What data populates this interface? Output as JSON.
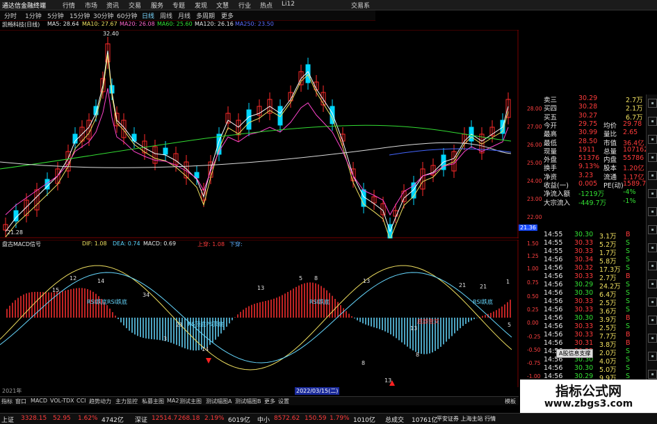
{
  "menu": {
    "app_title": "通达信金融终端",
    "items": [
      "行情",
      "市场",
      "资讯",
      "交易",
      "服务",
      "专题",
      "发现",
      "文慧",
      "行业",
      "热点",
      "Li12"
    ],
    "right_label": "交易系"
  },
  "period_tabs": [
    "分时",
    "1分钟",
    "5分钟",
    "15分钟",
    "30分钟",
    "60分钟",
    "日线",
    "周线",
    "月线",
    "多周期",
    "更多"
  ],
  "main_indicator": {
    "title": "凯畅科技(日线)",
    "ma5": "MA5: 28.64",
    "ma10": "MA10: 27.67",
    "ma20": "MA20: 26.08",
    "ma60": "MA60: 25.60",
    "ma120": "MA120: 26.16",
    "ma250": "MA250: 23.50",
    "high_mark": "32.40",
    "low_mark": "21.28",
    "last_price_tag": "21.36"
  },
  "macd_indicator": {
    "title": "盘古MACD信号",
    "dif": "DIF: 1.08",
    "dea": "DEA: 0.74",
    "macd": "MACD: 0.69",
    "up_label": "上穿: 1.08",
    "down_label": "下穿:",
    "labels": [
      "RSI跌底RSI跌底",
      "RSI跌底",
      "RSI跌底",
      "KS顶底PS顶底",
      "底部金叉"
    ],
    "numbers": [
      "12",
      "14",
      "15",
      "34",
      "13",
      "5",
      "8",
      "13",
      "3",
      "14",
      "21",
      "13",
      "8",
      "13",
      "21",
      "21",
      "1",
      "5",
      "8"
    ]
  },
  "right_scale": [
    "28.00",
    "27.00",
    "26.00",
    "25.00",
    "24.00",
    "23.00",
    "22.00",
    "1.50",
    "1.25",
    "1.00",
    "0.75",
    "0.50",
    "0.25",
    "0.00",
    "-0.25",
    "-0.50",
    "-0.75",
    "-1.00",
    "-1.25",
    "-1.50"
  ],
  "quote": [
    {
      "label": "卖三",
      "price": "30.29",
      "vol": "2.7万"
    },
    {
      "label": "买四",
      "price": "30.28",
      "vol": "2.1万"
    },
    {
      "label": "买五",
      "price": "30.27",
      "vol": "6.7万"
    },
    {
      "label": "今开",
      "price": "29.75",
      "label2": "均价",
      "val2": "29.78"
    },
    {
      "label": "最高",
      "price": "30.99",
      "label2": "量比",
      "val2": "2.65"
    },
    {
      "label": "最低",
      "price": "28.50",
      "label2": "市值",
      "val2": "36.4亿"
    },
    {
      "label": "现量",
      "price": "1911",
      "label2": "总量",
      "val2": "107162"
    },
    {
      "label": "外盘",
      "price": "51376",
      "label2": "内盘",
      "val2": "55786"
    },
    {
      "label": "换手",
      "price": "9.13%",
      "label2": "股本",
      "val2": "1.20亿"
    },
    {
      "label": "净资",
      "price": "3.23",
      "label2": "流通",
      "val2": "1.17亿"
    },
    {
      "label": "收益(一)",
      "price": "0.005",
      "label2": "PE(动)",
      "val2": "1589.7"
    },
    {
      "label": "净流入额",
      "price": "-1219万",
      "label2": "",
      "val2": "-4%"
    },
    {
      "label": "大宗流入",
      "price": "-449.7万",
      "label2": "",
      "val2": "-1%"
    }
  ],
  "ticks": [
    {
      "t": "14:55",
      "p": "30.30",
      "v": "3.1万",
      "d": "B"
    },
    {
      "t": "14:55",
      "p": "30.33",
      "v": "5.2万",
      "d": "S"
    },
    {
      "t": "14:55",
      "p": "30.33",
      "v": "1.7万",
      "d": "S"
    },
    {
      "t": "14:56",
      "p": "30.34",
      "v": "5.8万",
      "d": "S"
    },
    {
      "t": "14:56",
      "p": "30.32",
      "v": "17.3万",
      "d": "S"
    },
    {
      "t": "14:56",
      "p": "30.33",
      "v": "2.7万",
      "d": "B"
    },
    {
      "t": "14:56",
      "p": "30.29",
      "v": "24.2万",
      "d": "S"
    },
    {
      "t": "14:56",
      "p": "30.30",
      "v": "6.4万",
      "d": "S"
    },
    {
      "t": "14:56",
      "p": "30.33",
      "v": "2.5万",
      "d": "S"
    },
    {
      "t": "14:56",
      "p": "30.33",
      "v": "3.6万",
      "d": "S"
    },
    {
      "t": "14:56",
      "p": "30.30",
      "v": "3.9万",
      "d": "B"
    },
    {
      "t": "14:56",
      "p": "30.33",
      "v": "2.5万",
      "d": "S"
    },
    {
      "t": "14:56",
      "p": "30.33",
      "v": "7.7万",
      "d": "B"
    },
    {
      "t": "14:56",
      "p": "30.31",
      "v": "3.8万",
      "d": "B"
    },
    {
      "t": "14:56",
      "p": "30.32",
      "v": "2.0万",
      "d": "S"
    },
    {
      "t": "14:56",
      "p": "30.30",
      "v": "4.0万",
      "d": "S"
    },
    {
      "t": "14:56",
      "p": "30.30",
      "v": "5.0万",
      "d": "S"
    },
    {
      "t": "14:56",
      "p": "30.29",
      "v": "9.9万",
      "d": "S"
    },
    {
      "t": "14:56",
      "p": "30.30",
      "v": "2.5万",
      "d": "S"
    }
  ],
  "tick_popup": "A股信息支撑",
  "date_bar": {
    "left": "2021年",
    "marker": "2022/03/15(二)"
  },
  "bottom_tabs": [
    "指标",
    "窗口",
    "MACD",
    "VOL-TDX",
    "CCI",
    "趋势动力",
    "主力监控",
    "私募主图",
    "MA2",
    "测试主图",
    "测试幅图A",
    "测试幅图B",
    "更多",
    "设置"
  ],
  "bottom_right": "模板",
  "status": {
    "sh_label": "上证",
    "sh_val": "3328.15",
    "sh_chg": "52.95",
    "sh_pct": "1.62%",
    "sh_amt": "4742亿",
    "sz_label": "深证",
    "sz_val": "12514.7",
    "sz_chg": "268.18",
    "sz_pct": "2.19%",
    "sz_amt": "6019亿",
    "zx_label": "中小",
    "zx_val": "8572.62",
    "zx_chg": "150.59",
    "zx_pct": "1.79%",
    "zx_amt": "1010亿",
    "total_label": "总成交",
    "total_val": "10761亿",
    "broker": "平安证券 上海主站 行情"
  },
  "watermark": {
    "line1": "指标公式网",
    "line2": "www.zbgs3.com"
  }
}
